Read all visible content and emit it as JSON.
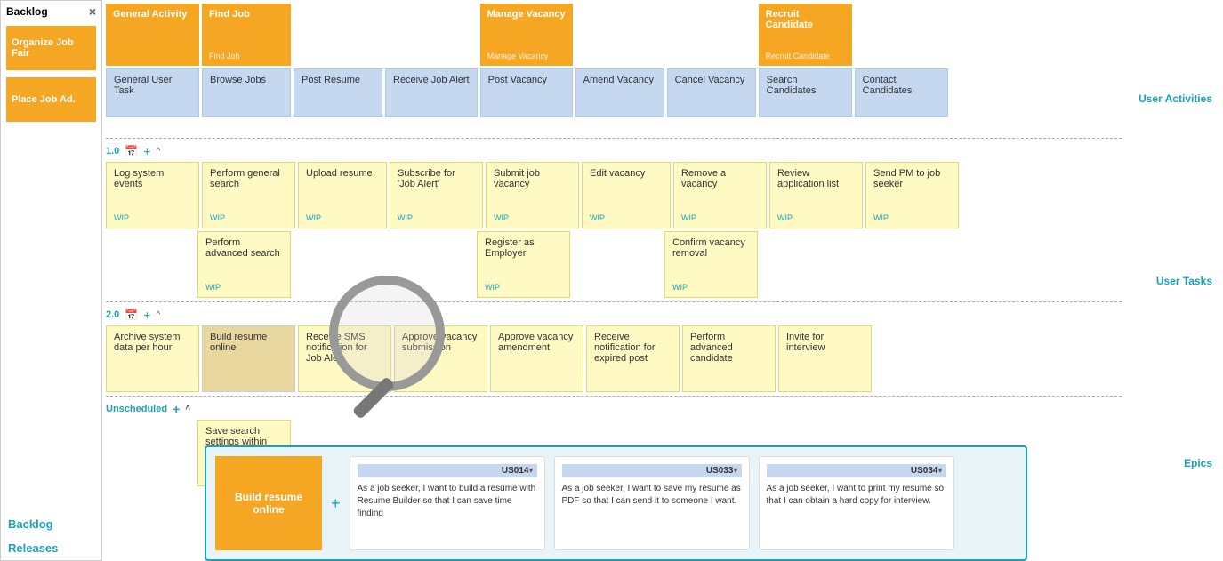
{
  "backlog": {
    "title": "Backlog",
    "close_icon": "×",
    "items": [
      {
        "label": "Organize Job Fair"
      },
      {
        "label": "Place Job Ad."
      }
    ],
    "backlog_label": "Backlog",
    "releases_label": "Releases"
  },
  "right_labels": {
    "user_activities": "User Activities",
    "user_tasks": "User Tasks",
    "epics": "Epics"
  },
  "header_row": {
    "activity_cards": [
      {
        "id": "ga",
        "label": "General Activity",
        "sub": ""
      },
      {
        "id": "fj",
        "label": "Find Job",
        "sub": "Find Job"
      },
      {
        "id": "mv",
        "label": "Manage Vacancy",
        "sub": "Manage Vacancy"
      },
      {
        "id": "rc",
        "label": "Recruit Candidate",
        "sub": "Recruit Candidate"
      }
    ],
    "task_cards": [
      {
        "label": "General User Task"
      },
      {
        "label": "Browse Jobs"
      },
      {
        "label": "Post Resume"
      },
      {
        "label": "Receive Job Alert"
      },
      {
        "label": "Post Vacancy"
      },
      {
        "label": "Amend Vacancy"
      },
      {
        "label": "Cancel Vacancy"
      },
      {
        "label": "Search Candidates"
      },
      {
        "label": "Contact Candidates"
      }
    ]
  },
  "release_1": {
    "number": "1.0",
    "calendar_icon": "📅",
    "plus": "+",
    "caret": "^",
    "cards": [
      {
        "label": "Log system events",
        "wip": "WIP"
      },
      {
        "label": "Perform general search",
        "wip": "WIP"
      },
      {
        "label": "Upload resume",
        "wip": "WIP"
      },
      {
        "label": "Subscribe for 'Job Alert'",
        "wip": "WIP"
      },
      {
        "label": "Submit job vacancy",
        "wip": "WIP"
      },
      {
        "label": "Edit vacancy",
        "wip": "WIP"
      },
      {
        "label": "Remove a vacancy",
        "wip": "WIP"
      },
      {
        "label": "Review application list",
        "wip": "WIP"
      },
      {
        "label": "Send PM to job seeker",
        "wip": "WIP"
      }
    ],
    "cards_row2": [
      {
        "label": "Perform advanced search",
        "wip": "WIP"
      },
      {
        "label": "Register as Employer",
        "wip": "WIP"
      },
      {
        "label": "Confirm vacancy removal",
        "wip": "WIP"
      }
    ]
  },
  "release_2": {
    "number": "2.0",
    "calendar_icon": "📅",
    "plus": "+",
    "caret": "^",
    "cards": [
      {
        "label": "Archive system data per hour",
        "wip": ""
      },
      {
        "label": "Build resume online",
        "wip": ""
      },
      {
        "label": "Receive SMS notification for Job Alert",
        "wip": ""
      },
      {
        "label": "Approve vacancy submission",
        "wip": ""
      },
      {
        "label": "Approve vacancy amendment",
        "wip": ""
      },
      {
        "label": "Receive notification for expired post",
        "wip": ""
      },
      {
        "label": "Perform advanced candidate",
        "wip": ""
      },
      {
        "label": "Invite for interview",
        "wip": ""
      }
    ]
  },
  "unscheduled": {
    "label": "Unscheduled",
    "plus": "+",
    "caret": "^",
    "cards": [
      {
        "label": "Save search settings within session"
      }
    ]
  },
  "expanded": {
    "main_card": "Build resume online",
    "plus": "+",
    "stories": [
      {
        "id": "US014",
        "text": "As a job seeker, I want to build a resume with Resume Builder so that I can save time finding"
      },
      {
        "id": "US033",
        "text": "As a job seeker, I want to save my resume as PDF so that I can send it to someone I want."
      },
      {
        "id": "US034",
        "text": "As a job seeker, I want to print my resume so that I can obtain a hard copy for interview."
      }
    ]
  }
}
